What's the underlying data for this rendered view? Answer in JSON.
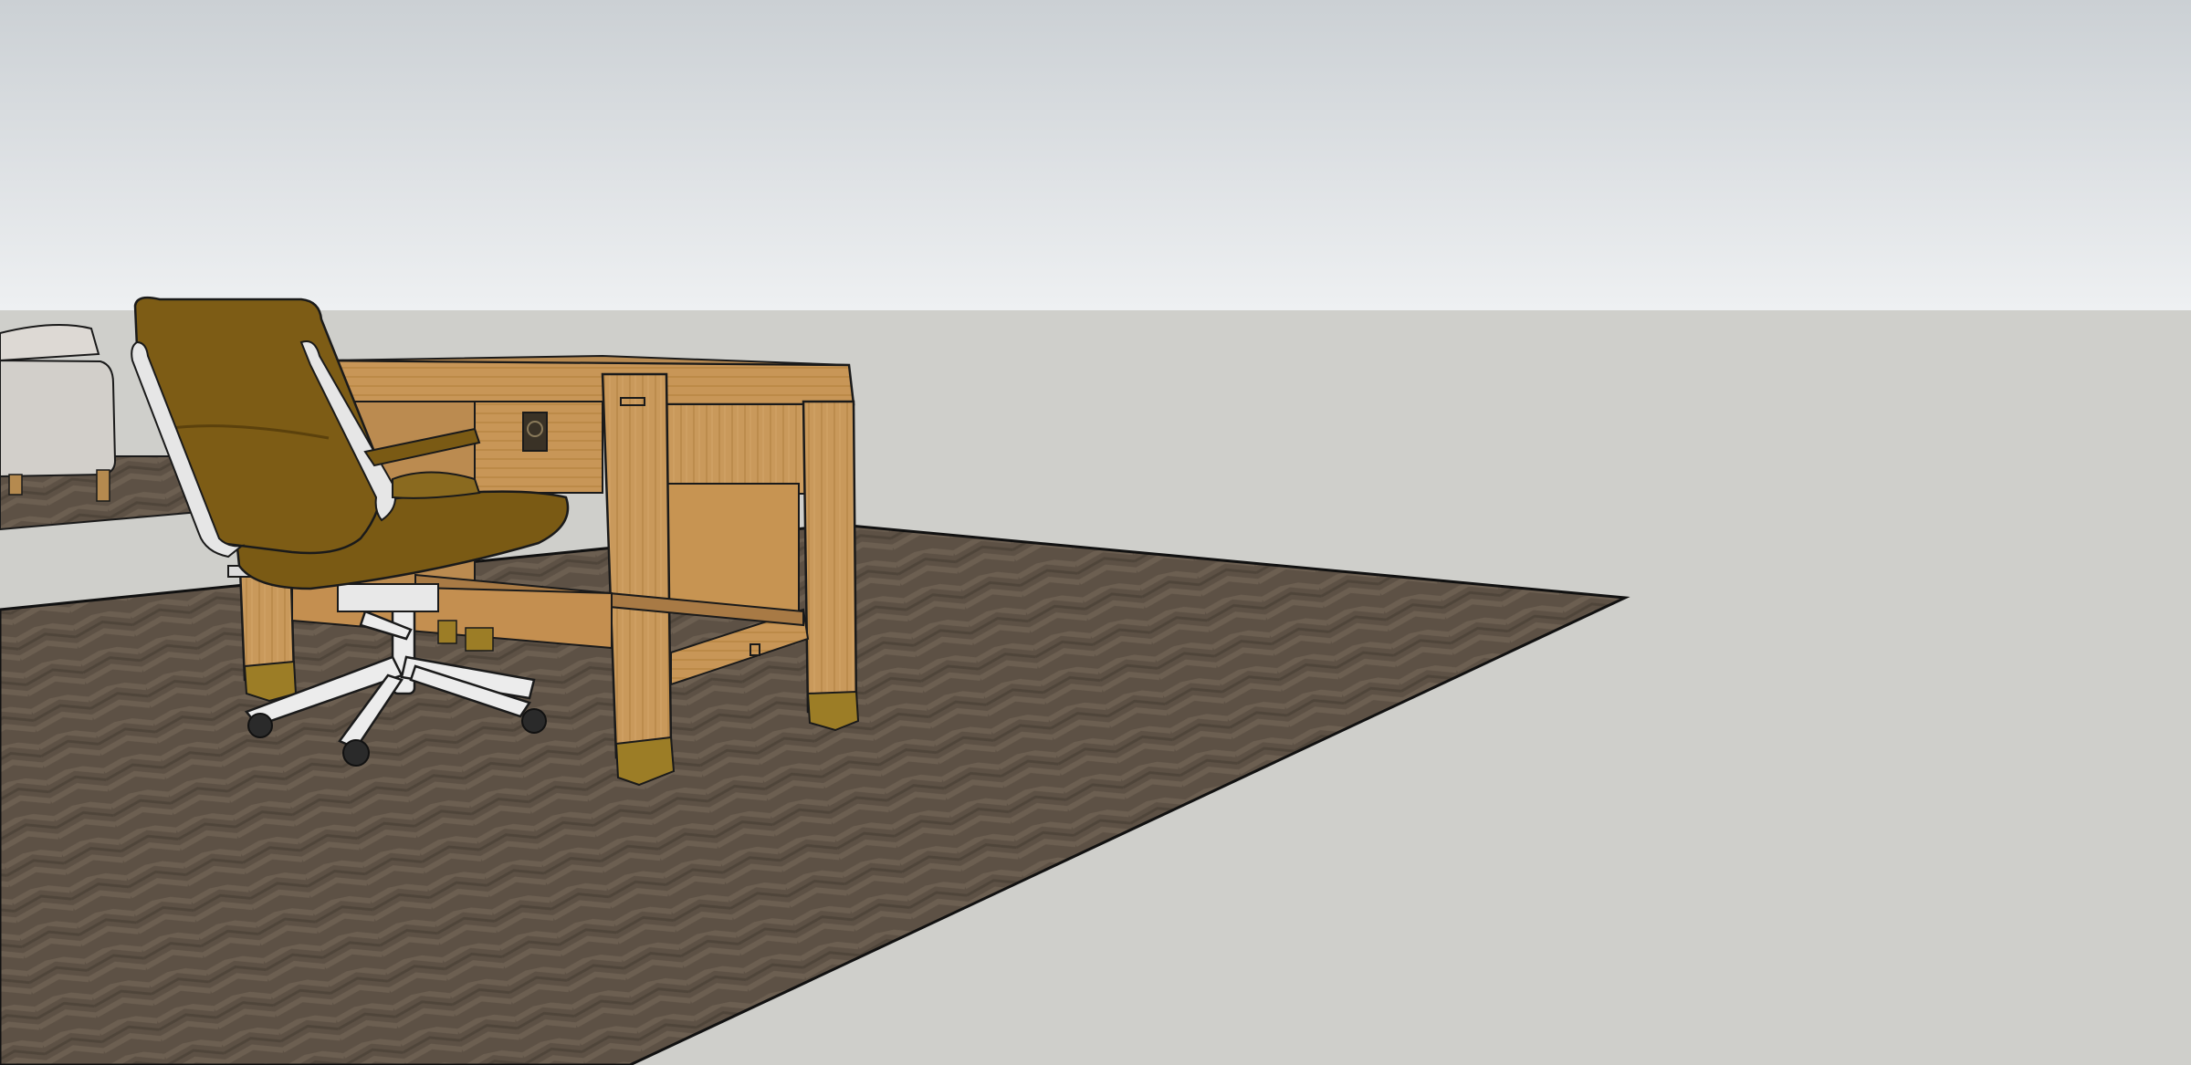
{
  "scene": {
    "type": "3d-modeling-viewport",
    "colors": {
      "sky_top": "#cbd0d4",
      "sky_bottom": "#eef0f2",
      "ground": "#cfcfcb",
      "rug": "#5d5145",
      "oak": "#c9995b",
      "oak_dark": "#a87a45",
      "brass": "#9c7d26",
      "chair_leather": "#7a5a14",
      "chair_frame": "#e8e8e8",
      "sofa": "#d7d4cf",
      "edge": "#1a1a1a"
    },
    "objects": [
      {
        "name": "sky",
        "icon": "sky-gradient"
      },
      {
        "name": "ground-plane",
        "icon": "ground-plane"
      },
      {
        "name": "herringbone-rug",
        "icon": "rug-texture"
      },
      {
        "name": "side-rug",
        "icon": "rug-texture"
      },
      {
        "name": "sofa",
        "icon": "sofa-icon"
      },
      {
        "name": "writing-desk",
        "icon": "desk-icon"
      },
      {
        "name": "office-chair",
        "icon": "chair-icon"
      }
    ]
  }
}
